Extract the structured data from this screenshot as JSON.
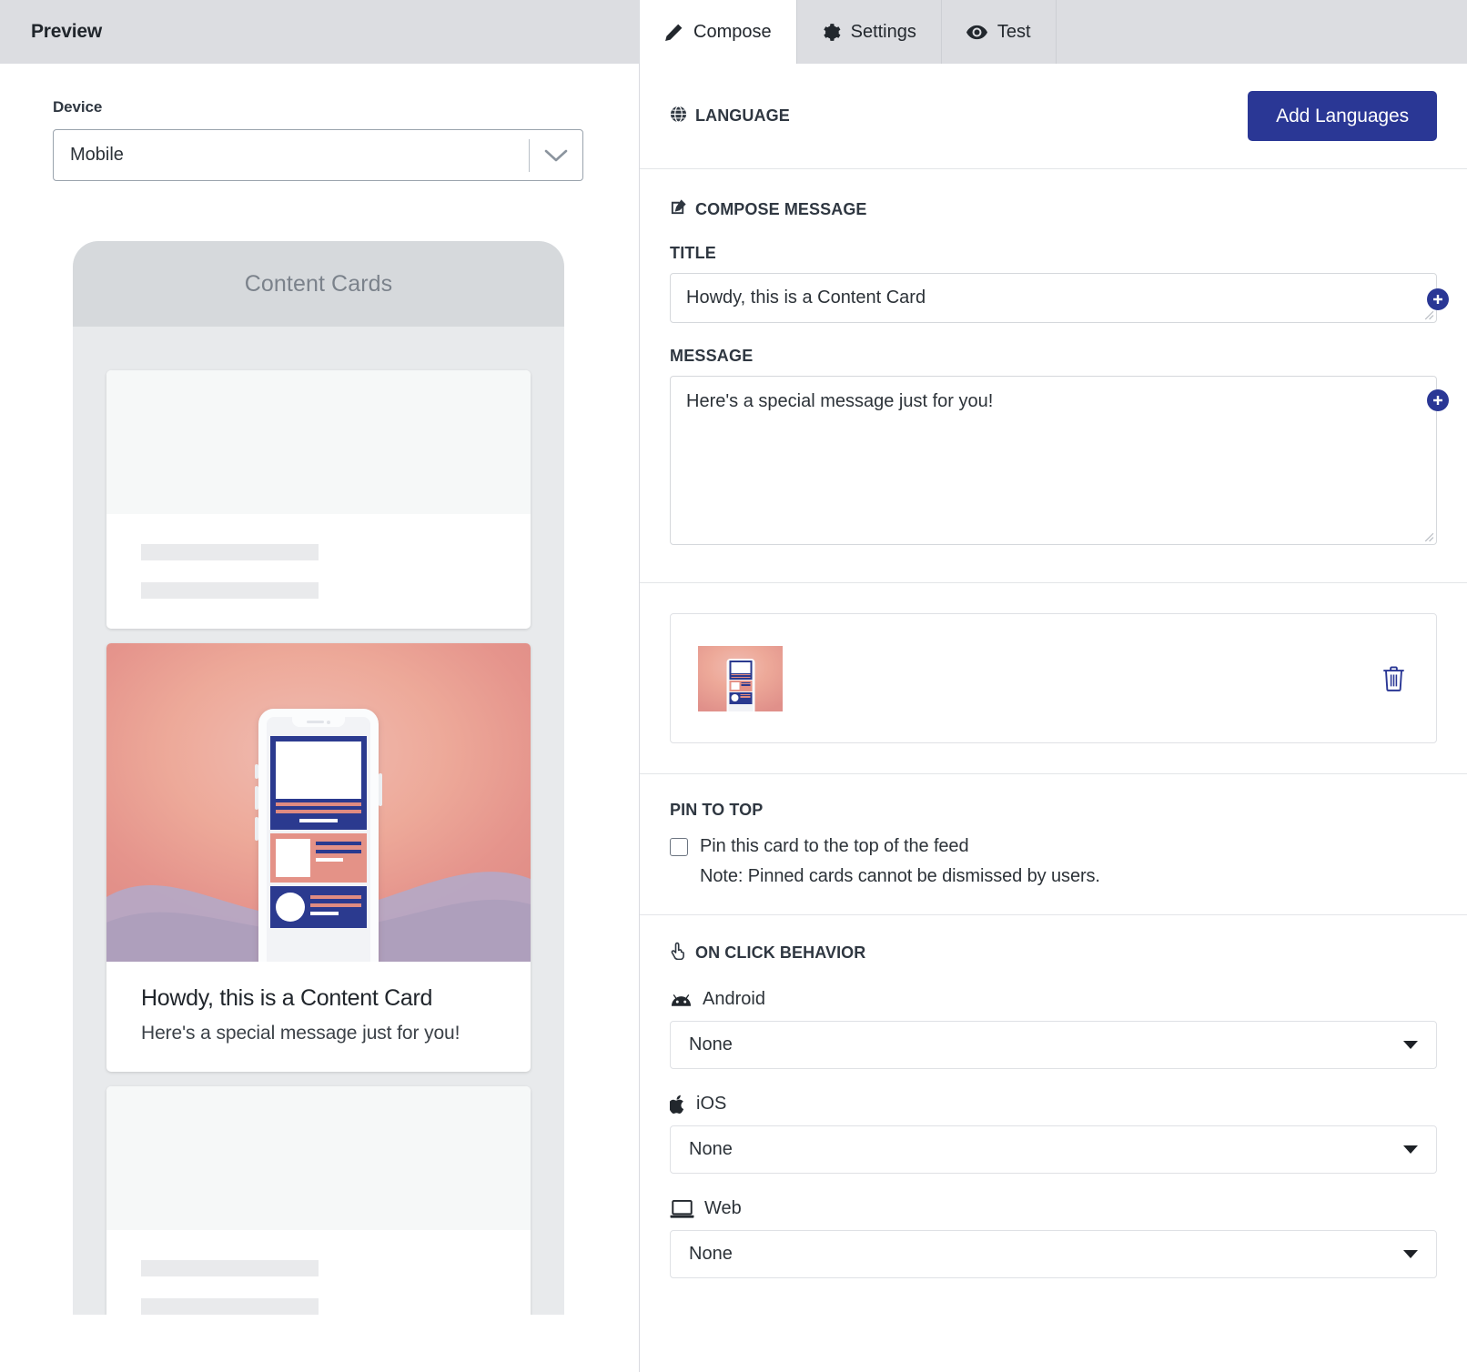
{
  "preview": {
    "header_title": "Preview",
    "device_label": "Device",
    "device_value": "Mobile",
    "phone_topbar_title": "Content Cards",
    "card": {
      "title": "Howdy, this is a Content Card",
      "message": "Here's a special message just for you!"
    }
  },
  "editor": {
    "tabs": [
      {
        "label": "Compose",
        "icon": "pencil-icon",
        "active": true
      },
      {
        "label": "Settings",
        "icon": "gear-icon",
        "active": false
      },
      {
        "label": "Test",
        "icon": "eye-icon",
        "active": false
      }
    ],
    "language": {
      "heading": "LANGUAGE",
      "icon": "globe-icon",
      "add_button": "Add Languages"
    },
    "compose": {
      "heading": "COMPOSE MESSAGE",
      "icon": "edit-square-icon",
      "title_label": "TITLE",
      "title_value": "Howdy, this is a Content Card",
      "title_placeholder": "Howdy, this is a Content Card",
      "message_label": "MESSAGE",
      "message_value": "Here's a special message just for you!",
      "message_placeholder": "Here's a special message just for you!"
    },
    "asset": {
      "thumbnail_name": "content-card-image-thumbnail",
      "delete_icon": "trash-icon"
    },
    "pin": {
      "heading": "PIN TO TOP",
      "checkbox_label": "Pin this card to the top of the feed",
      "checked": false,
      "note": "Note: Pinned cards cannot be dismissed by users."
    },
    "on_click": {
      "heading": "ON CLICK BEHAVIOR",
      "icon": "pointer-hand-icon",
      "platforms": [
        {
          "name": "Android",
          "icon": "android-icon",
          "value": "None"
        },
        {
          "name": "iOS",
          "icon": "apple-icon",
          "value": "None"
        },
        {
          "name": "Web",
          "icon": "laptop-icon",
          "value": "None"
        }
      ]
    }
  },
  "colors": {
    "primary": "#2a3795",
    "header_bg": "#dcdde1",
    "text": "#2c3238"
  }
}
